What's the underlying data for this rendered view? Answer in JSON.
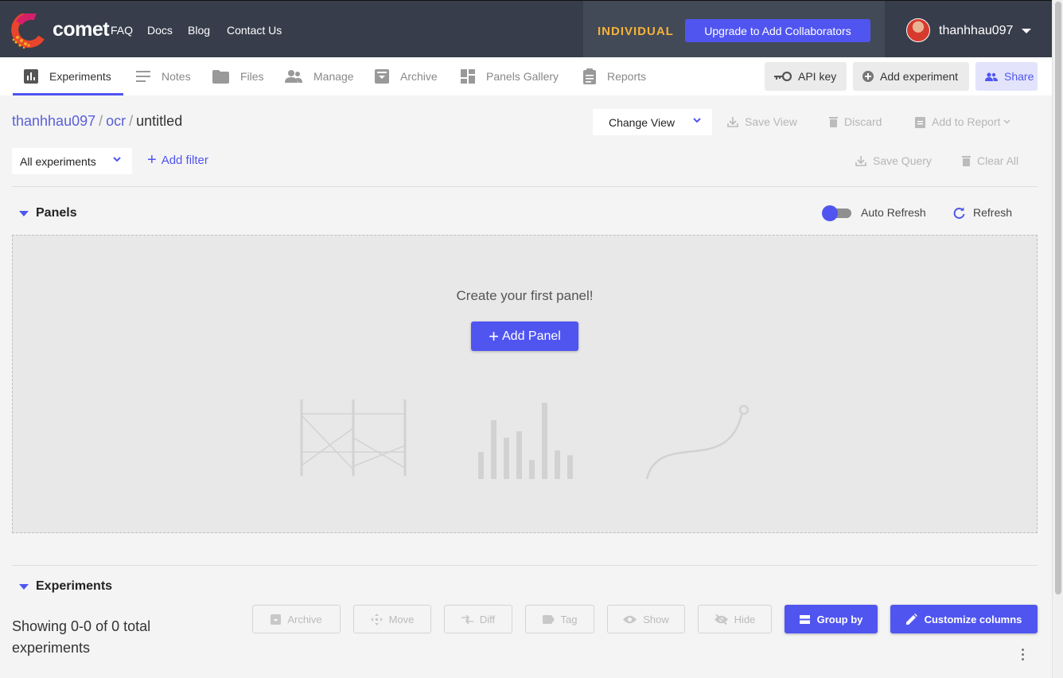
{
  "topbar": {
    "brand": "comet",
    "nav": [
      "FAQ",
      "Docs",
      "Blog",
      "Contact Us"
    ],
    "plan": "INDIVIDUAL",
    "upgrade_label": "Upgrade to Add Collaborators",
    "username": "thanhhau097"
  },
  "tabs": [
    {
      "label": "Experiments",
      "icon": "bar-chart-icon",
      "active": true
    },
    {
      "label": "Notes",
      "icon": "notes-icon"
    },
    {
      "label": "Files",
      "icon": "folder-icon"
    },
    {
      "label": "Manage",
      "icon": "people-icon"
    },
    {
      "label": "Archive",
      "icon": "archive-icon"
    },
    {
      "label": "Panels Gallery",
      "icon": "dashboard-icon"
    },
    {
      "label": "Reports",
      "icon": "report-icon"
    }
  ],
  "actions": {
    "api_key": "API key",
    "add_experiment": "Add experiment",
    "share": "Share"
  },
  "breadcrumb": {
    "workspace": "thanhhau097",
    "project": "ocr",
    "view": "untitled",
    "separator": "/"
  },
  "view_controls": {
    "change_view": "Change View",
    "save_view": "Save View",
    "discard": "Discard",
    "add_to_report": "Add to Report"
  },
  "filters": {
    "selector": "All experiments",
    "add_filter": "Add filter",
    "save_query": "Save Query",
    "clear_all": "Clear All"
  },
  "panels": {
    "title": "Panels",
    "auto_refresh": "Auto Refresh",
    "auto_refresh_on": true,
    "refresh": "Refresh",
    "empty_message": "Create your first panel!",
    "add_panel": "Add Panel"
  },
  "experiments": {
    "title": "Experiments",
    "showing": "Showing 0-0 of 0 total experiments",
    "toolbar": {
      "archive": "Archive",
      "move": "Move",
      "diff": "Diff",
      "tag": "Tag",
      "show": "Show",
      "hide": "Hide",
      "group_by": "Group by",
      "customize_columns": "Customize columns"
    }
  },
  "colors": {
    "accent": "#5055f0",
    "topbar": "#373d4a",
    "plan": "#f5b23c",
    "link": "#5a60d8"
  }
}
